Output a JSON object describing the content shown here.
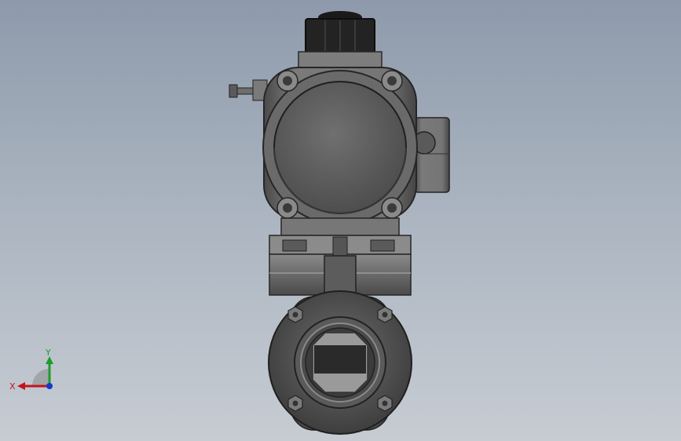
{
  "view": {
    "colors": {
      "background_top": "#8e9aab",
      "background_bottom": "#c7ccd3",
      "body": "#6b6b6b",
      "body_dark": "#3a3a3a",
      "face": "#5f5f5f",
      "knob": "#232323",
      "x_axis": "#c0161b",
      "y_axis": "#1e9b2b",
      "z_axis": "#1638c8"
    }
  },
  "triad": {
    "x_label": "X",
    "y_label": "Y",
    "icons": [
      "x-axis-arrow",
      "y-axis-arrow",
      "z-axis-dot"
    ]
  }
}
